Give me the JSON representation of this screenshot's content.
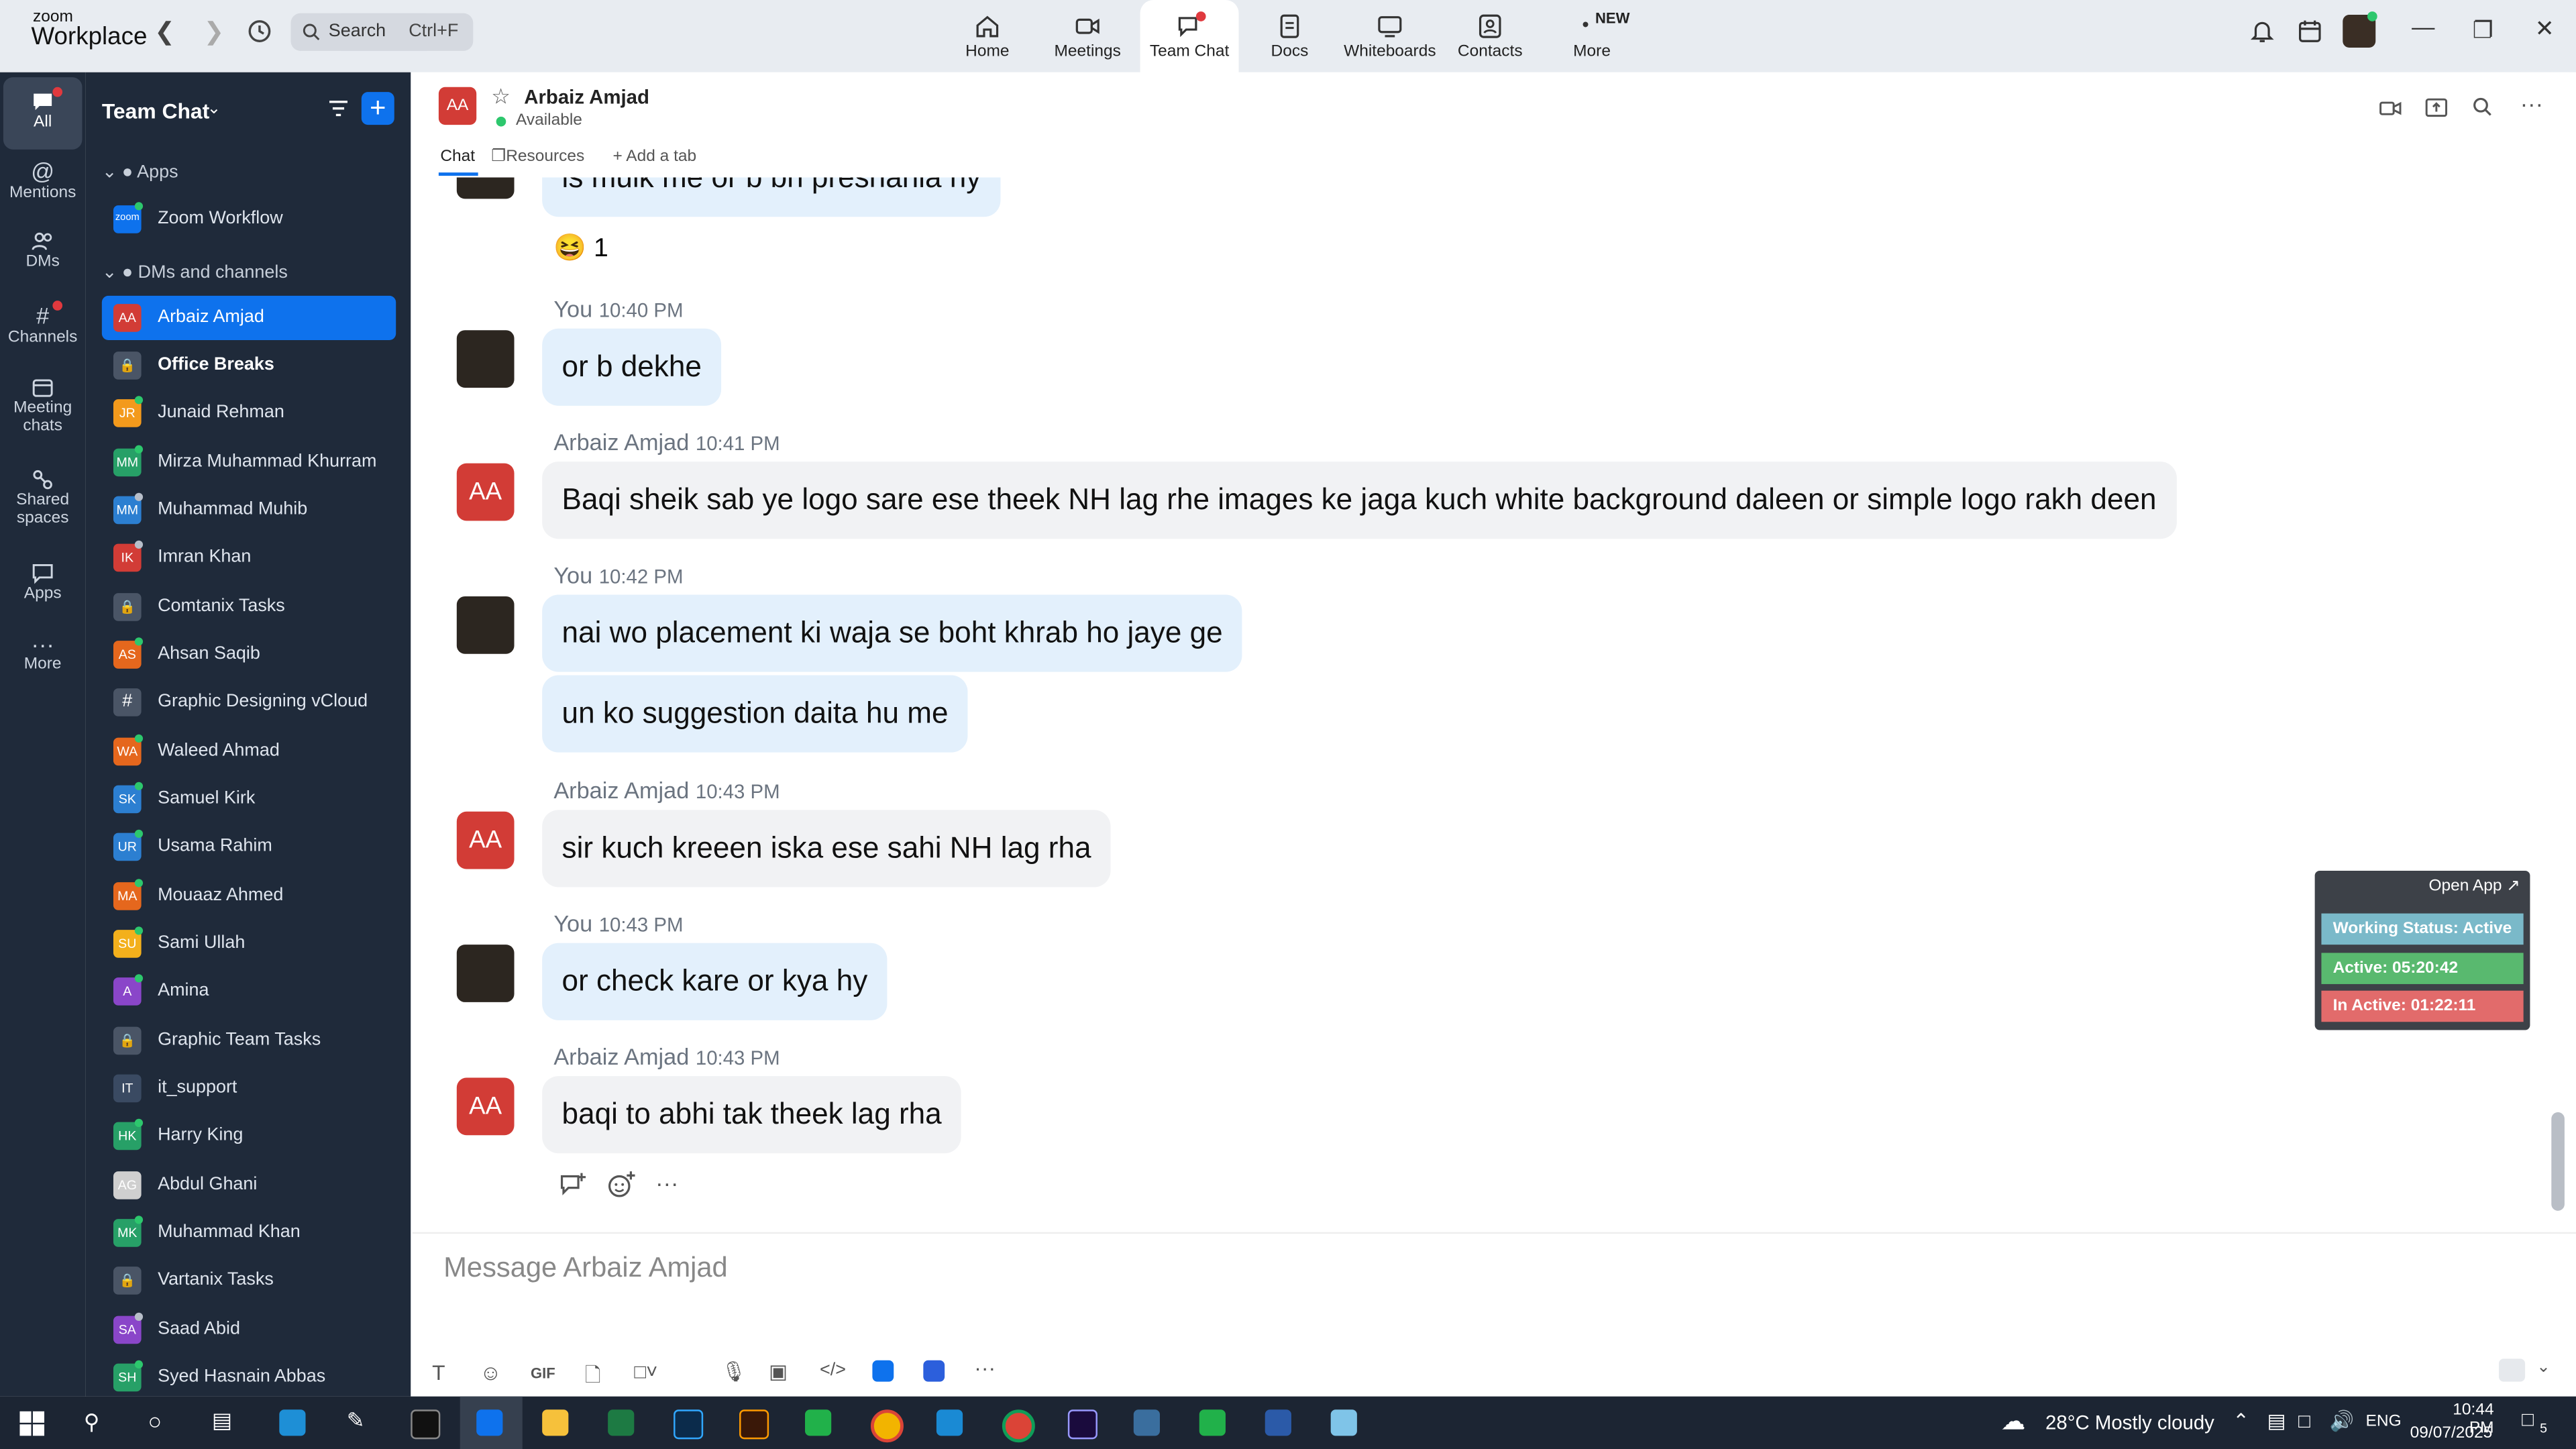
{
  "topbar": {
    "logo_small": "zoom",
    "logo_big": "Workplace",
    "search_placeholder": "Search",
    "search_shortcut": "Ctrl+F",
    "nav": [
      {
        "label": "Home"
      },
      {
        "label": "Meetings"
      },
      {
        "label": "Team Chat"
      },
      {
        "label": "Docs"
      },
      {
        "label": "Whiteboards"
      },
      {
        "label": "Contacts"
      },
      {
        "label": "More"
      }
    ],
    "new_badge": "NEW"
  },
  "rail": {
    "items": [
      {
        "label": "All"
      },
      {
        "label": "Mentions"
      },
      {
        "label": "DMs"
      },
      {
        "label": "Channels"
      },
      {
        "label": "Meeting chats"
      },
      {
        "label": "Shared spaces"
      },
      {
        "label": "Apps"
      },
      {
        "label": "More"
      }
    ]
  },
  "sidebar": {
    "title": "Team Chat",
    "section_apps": "Apps",
    "section_dms": "DMs and channels",
    "items": [
      {
        "name": "Zoom Workflow",
        "initials": "zoom",
        "color": "#0e72ed"
      },
      {
        "name": "Arbaiz Amjad",
        "initials": "AA",
        "color": "#d23c36"
      },
      {
        "name": "Office Breaks",
        "initials": "",
        "color": "#4a5566"
      },
      {
        "name": "Junaid Rehman",
        "initials": "JR",
        "color": "#f39a1c"
      },
      {
        "name": "Mirza Muhammad Khurram",
        "initials": "MM",
        "color": "#27a067"
      },
      {
        "name": "Muhammad Muhib",
        "initials": "MM",
        "color": "#2c7fd1"
      },
      {
        "name": "Imran Khan",
        "initials": "IK",
        "color": "#d23c36"
      },
      {
        "name": "Comtanix Tasks",
        "initials": "",
        "color": "#4a5566"
      },
      {
        "name": "Ahsan Saqib",
        "initials": "AS",
        "color": "#e5671d"
      },
      {
        "name": "Graphic Designing vCloud",
        "initials": "#",
        "color": "#4a5566"
      },
      {
        "name": "Waleed Ahmad",
        "initials": "WA",
        "color": "#e5671d"
      },
      {
        "name": "Samuel Kirk",
        "initials": "SK",
        "color": "#2c7fd1"
      },
      {
        "name": "Usama Rahim",
        "initials": "UR",
        "color": "#2c7fd1"
      },
      {
        "name": "Mouaaz Ahmed",
        "initials": "MA",
        "color": "#e5671d"
      },
      {
        "name": "Sami Ullah",
        "initials": "SU",
        "color": "#f3b01c"
      },
      {
        "name": "Amina",
        "initials": "A",
        "color": "#8a46c9"
      },
      {
        "name": "Graphic Team Tasks",
        "initials": "",
        "color": "#4a5566"
      },
      {
        "name": "it_support",
        "initials": "IT",
        "color": "#3a4a62"
      },
      {
        "name": "Harry King",
        "initials": "HK",
        "color": "#27a067"
      },
      {
        "name": "Abdul Ghani",
        "initials": "AG",
        "color": "#cfcfcf"
      },
      {
        "name": "Muhammad Khan",
        "initials": "MK",
        "color": "#27a067"
      },
      {
        "name": "Vartanix Tasks",
        "initials": "",
        "color": "#4a5566"
      },
      {
        "name": "Saad Abid",
        "initials": "SA",
        "color": "#8a46c9"
      },
      {
        "name": "Syed Hasnain Abbas",
        "initials": "SH",
        "color": "#27a067"
      }
    ]
  },
  "chat": {
    "contact_initials": "AA",
    "contact_name": "Arbaiz Amjad",
    "contact_status": "Available",
    "tabs": [
      {
        "label": "Chat"
      },
      {
        "label": "Resources"
      },
      {
        "label": "Add a tab"
      }
    ],
    "messages": [
      {
        "sender": "",
        "time": "",
        "text": "is mulk me or b bh preshania hy"
      },
      {
        "sender": "You",
        "time": "10:40 PM",
        "text": "or b dekhe"
      },
      {
        "sender": "Arbaiz Amjad",
        "time": "10:41 PM",
        "text": "Baqi sheik sab ye logo sare ese theek NH lag rhe images ke jaga kuch white background daleen or simple logo rakh deen"
      },
      {
        "sender": "You",
        "time": "10:42 PM",
        "text": "nai wo placement ki waja se boht khrab ho jaye ge"
      },
      {
        "sender": "",
        "time": "",
        "text": "un ko suggestion daita hu me"
      },
      {
        "sender": "Arbaiz Amjad",
        "time": "10:43 PM",
        "text": "sir kuch kreeen iska ese sahi NH lag rha"
      },
      {
        "sender": "You",
        "time": "10:43 PM",
        "text": "or check kare or kya hy"
      },
      {
        "sender": "Arbaiz Amjad",
        "time": "10:43 PM",
        "text": "baqi to abhi tak theek lag rha"
      }
    ],
    "reaction_count": "1",
    "composer_placeholder": "Message Arbaiz Amjad"
  },
  "widget": {
    "open_app": "Open App ↗",
    "working_status": "Working Status: Active",
    "active": "Active: 05:20:42",
    "inactive": "In Active: 01:22:11"
  },
  "taskbar": {
    "weather": "28°C  Mostly cloudy",
    "lang": "ENG",
    "time": "10:44 PM",
    "date": "09/07/2025",
    "notif_count": "5"
  }
}
